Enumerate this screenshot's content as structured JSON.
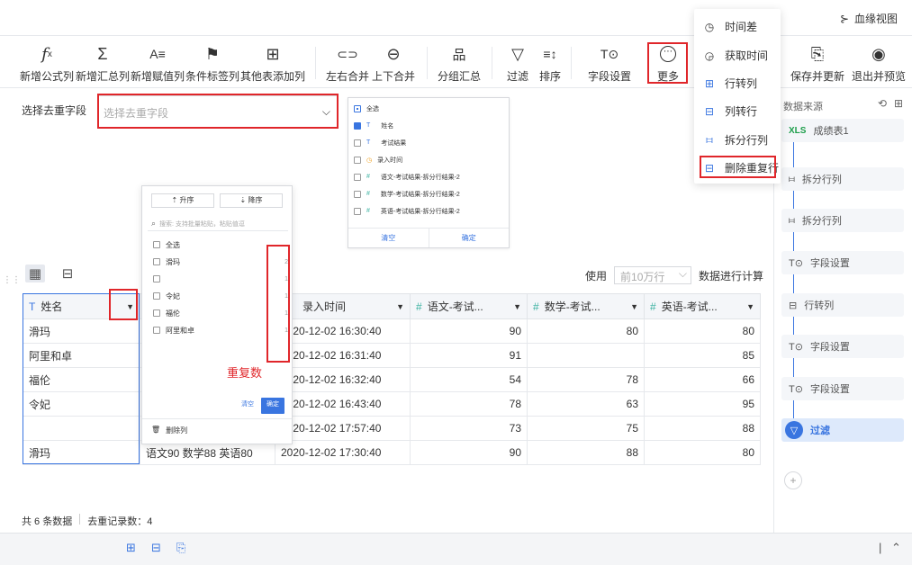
{
  "topbar": {
    "lineage_label": "血缘视图"
  },
  "toolbar": {
    "items": [
      {
        "icon": "fx",
        "label": "新增公式列"
      },
      {
        "icon": "Σ",
        "label": "新增汇总列"
      },
      {
        "icon": "A≡",
        "label": "新增赋值列"
      },
      {
        "icon": "⚑",
        "label": "条件标签列"
      },
      {
        "icon": "⊞",
        "label": "其他表添加列"
      },
      {
        "icon": "⊂⊃",
        "label": "左右合并"
      },
      {
        "icon": "⊖",
        "label": "上下合并"
      },
      {
        "icon": "品",
        "label": "分组汇总"
      },
      {
        "icon": "▽",
        "label": "过滤"
      },
      {
        "icon": "≡↕",
        "label": "排序"
      },
      {
        "icon": "T⊙",
        "label": "字段设置"
      },
      {
        "icon": "⋯",
        "label": "更多"
      },
      {
        "icon": "⎘",
        "label": "保存并更新"
      },
      {
        "icon": "◉",
        "label": "退出并预览"
      }
    ]
  },
  "dedupe": {
    "label": "选择去重字段",
    "placeholder": "选择去重字段"
  },
  "field_panel": {
    "items": [
      {
        "type": "all",
        "label": "全选",
        "checked": false
      },
      {
        "type": "T",
        "label": "姓名",
        "checked": true
      },
      {
        "type": "T",
        "label": "考试结果",
        "checked": false
      },
      {
        "type": "clock",
        "label": "录入时间",
        "checked": false
      },
      {
        "type": "#",
        "label": "语文-考试结果-拆分行结果-2",
        "checked": false
      },
      {
        "type": "#",
        "label": "数学-考试结果-拆分行结果-2",
        "checked": false
      },
      {
        "type": "#",
        "label": "英语-考试结果-拆分行结果-2",
        "checked": false
      }
    ],
    "clear": "清空",
    "confirm": "确定"
  },
  "sort_panel": {
    "asc": "升序",
    "desc": "降序",
    "search_placeholder": "搜索: 支持批量粘贴，粘贴值逗",
    "items": [
      {
        "label": "全选",
        "count": ""
      },
      {
        "label": "滑玛",
        "count": "2"
      },
      {
        "label": "",
        "count": "1"
      },
      {
        "label": "令妃",
        "count": "1"
      },
      {
        "label": "福伦",
        "count": "1"
      },
      {
        "label": "阿里和卓",
        "count": "1"
      }
    ],
    "clear": "清空",
    "confirm": "确定",
    "delete_col": "删除列"
  },
  "dup_annotation": "重复数",
  "use_bar": {
    "use": "使用",
    "rows": "前10万行",
    "calc": "数据进行计算"
  },
  "table": {
    "headers": [
      "姓名",
      "",
      "录入时间",
      "语文-考试...",
      "数学-考试...",
      "英语-考试..."
    ],
    "rows": [
      [
        "滑玛",
        "",
        "2020-12-02 16:30:40",
        "90",
        "80",
        "80"
      ],
      [
        "阿里和卓",
        "",
        "2020-12-02 16:31:40",
        "91",
        "",
        "85"
      ],
      [
        "福伦",
        "",
        "2020-12-02 16:32:40",
        "54",
        "78",
        "66"
      ],
      [
        "令妃",
        "",
        "2020-12-02 16:43:40",
        "78",
        "63",
        "95"
      ],
      [
        "",
        "",
        "2020-12-02 17:57:40",
        "73",
        "75",
        "88"
      ],
      [
        "滑玛",
        "语文90 数学88 英语80",
        "2020-12-02 17:30:40",
        "90",
        "88",
        "80"
      ]
    ]
  },
  "status": {
    "total": "共 6 条数据",
    "dedupe": "去重记录数：4"
  },
  "right_panel": {
    "title": "数据来源",
    "source": "成绩表1",
    "steps": [
      "拆分行列",
      "拆分行列",
      "字段设置",
      "行转列",
      "字段设置",
      "字段设置",
      "过滤"
    ]
  },
  "more_menu": {
    "items": [
      "时间差",
      "获取时间",
      "行转列",
      "列转行",
      "拆分行列",
      "删除重复行"
    ]
  }
}
